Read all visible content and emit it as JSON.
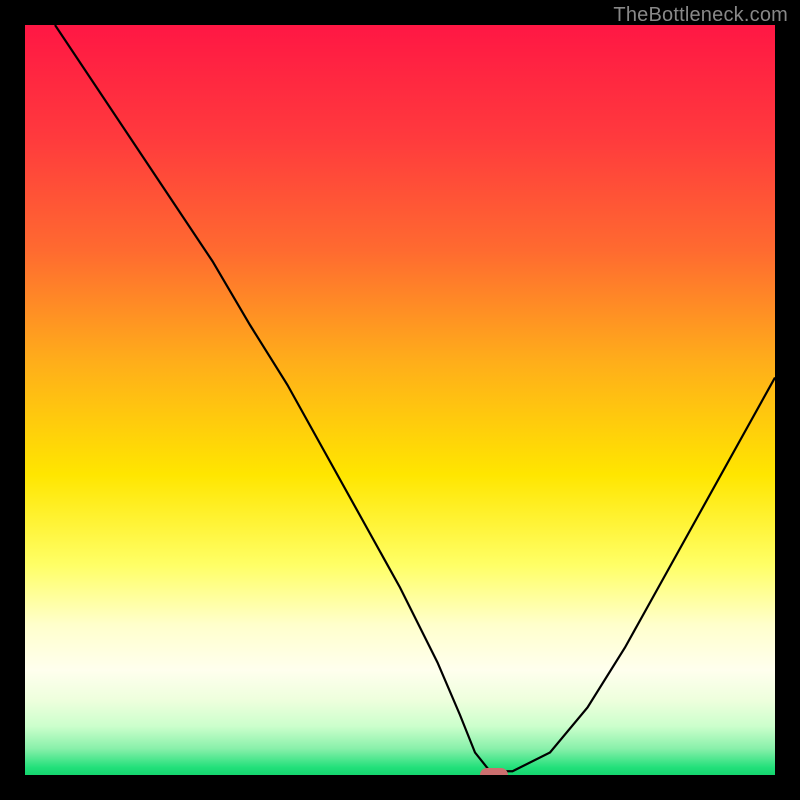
{
  "watermark": "TheBottleneck.com",
  "chart_data": {
    "type": "line",
    "title": "",
    "xlabel": "",
    "ylabel": "",
    "xlim": [
      0,
      100
    ],
    "ylim": [
      0,
      100
    ],
    "x": [
      4,
      10,
      20,
      25,
      30,
      35,
      40,
      45,
      50,
      55,
      58,
      60,
      62,
      65,
      70,
      75,
      80,
      85,
      90,
      95,
      100
    ],
    "values": [
      100,
      91,
      76,
      68.5,
      60,
      52,
      43,
      34,
      25,
      15,
      8,
      3,
      0.5,
      0.5,
      3,
      9,
      17,
      26,
      35,
      44,
      53
    ],
    "marker": {
      "x": 62.5,
      "y": 0
    },
    "gradient_stops": [
      {
        "offset": 0.0,
        "color": "#ff1744"
      },
      {
        "offset": 0.15,
        "color": "#ff3a3d"
      },
      {
        "offset": 0.3,
        "color": "#ff6a30"
      },
      {
        "offset": 0.45,
        "color": "#ffae1a"
      },
      {
        "offset": 0.6,
        "color": "#ffe600"
      },
      {
        "offset": 0.72,
        "color": "#ffff66"
      },
      {
        "offset": 0.8,
        "color": "#ffffcc"
      },
      {
        "offset": 0.86,
        "color": "#ffffee"
      },
      {
        "offset": 0.9,
        "color": "#eeffdd"
      },
      {
        "offset": 0.935,
        "color": "#ccffcc"
      },
      {
        "offset": 0.965,
        "color": "#88f0aa"
      },
      {
        "offset": 0.99,
        "color": "#22e07a"
      },
      {
        "offset": 1.0,
        "color": "#14d56e"
      }
    ]
  }
}
